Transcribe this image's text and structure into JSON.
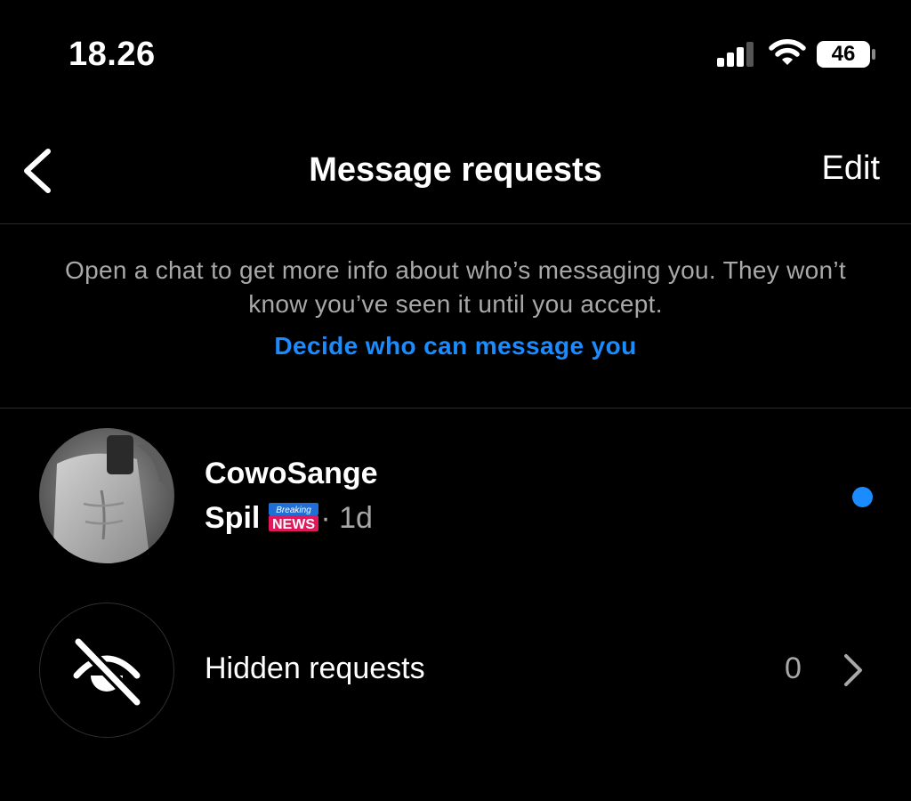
{
  "status": {
    "time": "18.26",
    "battery": "46"
  },
  "header": {
    "title": "Message requests",
    "edit_label": "Edit"
  },
  "info": {
    "text": "Open a chat to get more info about who’s messaging you. They won’t know you’ve seen it until you accept.",
    "link": "Decide who can message you"
  },
  "requests": [
    {
      "name": "CowoSange",
      "message": "Spil",
      "meta": "· 1d",
      "unread": true
    }
  ],
  "hidden": {
    "label": "Hidden requests",
    "count": "0"
  },
  "colors": {
    "accent": "#1a8cff",
    "background": "#000000",
    "secondary_text": "#a8a8a8"
  },
  "icons": [
    "back-chevron-icon",
    "cellular-signal-icon",
    "wifi-icon",
    "battery-icon",
    "breaking-news-emoji",
    "eye-slash-icon",
    "chevron-right-icon"
  ]
}
